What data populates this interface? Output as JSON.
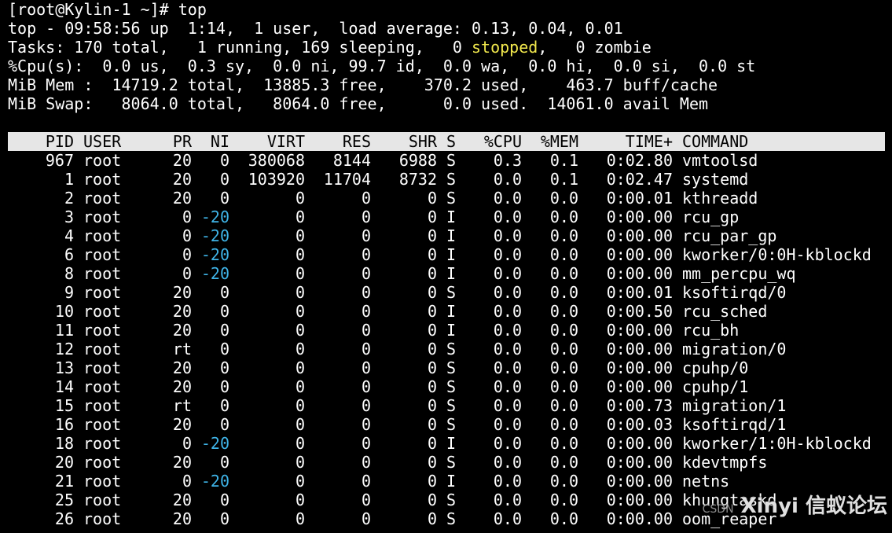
{
  "prompt": "[root@Kylin-1 ~]# top",
  "summary": {
    "line1": "top - 09:58:56 up  1:14,  1 user,  load average: 0.13, 0.04, 0.01",
    "tasks_pre": "Tasks: 170 total,   1 running, 169 sleeping,   0 ",
    "tasks_stopped": "stopped",
    "tasks_post": ",   0 zombie",
    "cpu": "%Cpu(s):  0.0 us,  0.3 sy,  0.0 ni, 99.7 id,  0.0 wa,  0.0 hi,  0.0 si,  0.0 st",
    "mem": "MiB Mem :  14719.2 total,  13885.3 free,    370.2 used,    463.7 buff/cache",
    "swap": "MiB Swap:   8064.0 total,   8064.0 free,      0.0 used.  14061.0 avail Mem"
  },
  "columns": {
    "pid": "PID",
    "user": "USER",
    "pr": "PR",
    "ni": "NI",
    "virt": "VIRT",
    "res": "RES",
    "shr": "SHR",
    "s": "S",
    "cpu": "%CPU",
    "mem": "%MEM",
    "time": "TIME+",
    "command": "COMMAND"
  },
  "processes": [
    {
      "pid": "967",
      "user": "root",
      "pr": "20",
      "ni": "0",
      "virt": "380068",
      "res": "8144",
      "shr": "6988",
      "s": "S",
      "cpu": "0.3",
      "mem": "0.1",
      "time": "0:02.80",
      "command": "vmtoolsd"
    },
    {
      "pid": "1",
      "user": "root",
      "pr": "20",
      "ni": "0",
      "virt": "103920",
      "res": "11704",
      "shr": "8732",
      "s": "S",
      "cpu": "0.0",
      "mem": "0.1",
      "time": "0:02.47",
      "command": "systemd"
    },
    {
      "pid": "2",
      "user": "root",
      "pr": "20",
      "ni": "0",
      "virt": "0",
      "res": "0",
      "shr": "0",
      "s": "S",
      "cpu": "0.0",
      "mem": "0.0",
      "time": "0:00.01",
      "command": "kthreadd"
    },
    {
      "pid": "3",
      "user": "root",
      "pr": "0",
      "ni": "-20",
      "virt": "0",
      "res": "0",
      "shr": "0",
      "s": "I",
      "cpu": "0.0",
      "mem": "0.0",
      "time": "0:00.00",
      "command": "rcu_gp"
    },
    {
      "pid": "4",
      "user": "root",
      "pr": "0",
      "ni": "-20",
      "virt": "0",
      "res": "0",
      "shr": "0",
      "s": "I",
      "cpu": "0.0",
      "mem": "0.0",
      "time": "0:00.00",
      "command": "rcu_par_gp"
    },
    {
      "pid": "6",
      "user": "root",
      "pr": "0",
      "ni": "-20",
      "virt": "0",
      "res": "0",
      "shr": "0",
      "s": "I",
      "cpu": "0.0",
      "mem": "0.0",
      "time": "0:00.00",
      "command": "kworker/0:0H-kblockd"
    },
    {
      "pid": "8",
      "user": "root",
      "pr": "0",
      "ni": "-20",
      "virt": "0",
      "res": "0",
      "shr": "0",
      "s": "I",
      "cpu": "0.0",
      "mem": "0.0",
      "time": "0:00.00",
      "command": "mm_percpu_wq"
    },
    {
      "pid": "9",
      "user": "root",
      "pr": "20",
      "ni": "0",
      "virt": "0",
      "res": "0",
      "shr": "0",
      "s": "S",
      "cpu": "0.0",
      "mem": "0.0",
      "time": "0:00.01",
      "command": "ksoftirqd/0"
    },
    {
      "pid": "10",
      "user": "root",
      "pr": "20",
      "ni": "0",
      "virt": "0",
      "res": "0",
      "shr": "0",
      "s": "I",
      "cpu": "0.0",
      "mem": "0.0",
      "time": "0:00.50",
      "command": "rcu_sched"
    },
    {
      "pid": "11",
      "user": "root",
      "pr": "20",
      "ni": "0",
      "virt": "0",
      "res": "0",
      "shr": "0",
      "s": "I",
      "cpu": "0.0",
      "mem": "0.0",
      "time": "0:00.00",
      "command": "rcu_bh"
    },
    {
      "pid": "12",
      "user": "root",
      "pr": "rt",
      "ni": "0",
      "virt": "0",
      "res": "0",
      "shr": "0",
      "s": "S",
      "cpu": "0.0",
      "mem": "0.0",
      "time": "0:00.00",
      "command": "migration/0"
    },
    {
      "pid": "13",
      "user": "root",
      "pr": "20",
      "ni": "0",
      "virt": "0",
      "res": "0",
      "shr": "0",
      "s": "S",
      "cpu": "0.0",
      "mem": "0.0",
      "time": "0:00.00",
      "command": "cpuhp/0"
    },
    {
      "pid": "14",
      "user": "root",
      "pr": "20",
      "ni": "0",
      "virt": "0",
      "res": "0",
      "shr": "0",
      "s": "S",
      "cpu": "0.0",
      "mem": "0.0",
      "time": "0:00.00",
      "command": "cpuhp/1"
    },
    {
      "pid": "15",
      "user": "root",
      "pr": "rt",
      "ni": "0",
      "virt": "0",
      "res": "0",
      "shr": "0",
      "s": "S",
      "cpu": "0.0",
      "mem": "0.0",
      "time": "0:00.73",
      "command": "migration/1"
    },
    {
      "pid": "16",
      "user": "root",
      "pr": "20",
      "ni": "0",
      "virt": "0",
      "res": "0",
      "shr": "0",
      "s": "S",
      "cpu": "0.0",
      "mem": "0.0",
      "time": "0:00.03",
      "command": "ksoftirqd/1"
    },
    {
      "pid": "18",
      "user": "root",
      "pr": "0",
      "ni": "-20",
      "virt": "0",
      "res": "0",
      "shr": "0",
      "s": "I",
      "cpu": "0.0",
      "mem": "0.0",
      "time": "0:00.00",
      "command": "kworker/1:0H-kblockd"
    },
    {
      "pid": "20",
      "user": "root",
      "pr": "20",
      "ni": "0",
      "virt": "0",
      "res": "0",
      "shr": "0",
      "s": "S",
      "cpu": "0.0",
      "mem": "0.0",
      "time": "0:00.00",
      "command": "kdevtmpfs"
    },
    {
      "pid": "21",
      "user": "root",
      "pr": "0",
      "ni": "-20",
      "virt": "0",
      "res": "0",
      "shr": "0",
      "s": "I",
      "cpu": "0.0",
      "mem": "0.0",
      "time": "0:00.00",
      "command": "netns"
    },
    {
      "pid": "25",
      "user": "root",
      "pr": "20",
      "ni": "0",
      "virt": "0",
      "res": "0",
      "shr": "0",
      "s": "S",
      "cpu": "0.0",
      "mem": "0.0",
      "time": "0:00.00",
      "command": "khungtaskd"
    },
    {
      "pid": "26",
      "user": "root",
      "pr": "20",
      "ni": "0",
      "virt": "0",
      "res": "0",
      "shr": "0",
      "s": "S",
      "cpu": "0.0",
      "mem": "0.0",
      "time": "0:00.00",
      "command": "oom_reaper"
    }
  ],
  "watermark": {
    "brand": "Xinyi 信蚁论坛",
    "csdn": "CSDN"
  },
  "colors": {
    "background": "#000000",
    "foreground": "#ffffff",
    "stopped": "#f1e84d",
    "negative_nice": "#3fb4e8",
    "header_bar": "#e6e6e6"
  }
}
